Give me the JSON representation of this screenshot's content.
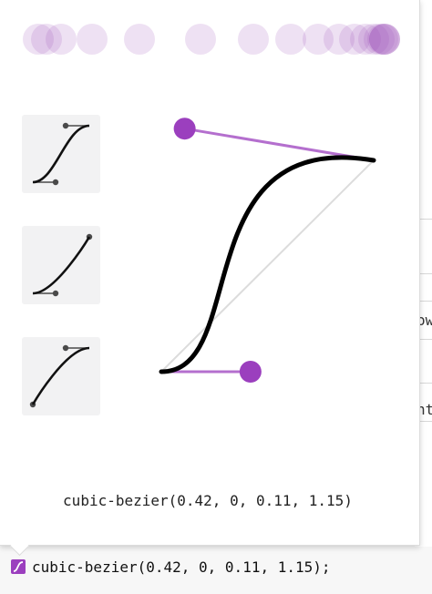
{
  "popover": {
    "timing_function": "cubic-bezier(0.42, 0, 0.11, 1.15)",
    "bezier": {
      "x1": 0.42,
      "y1": 0,
      "x2": 0.11,
      "y2": 1.15
    },
    "accent_color": "#9b3fbe",
    "presets": [
      {
        "name": "ease-in-out"
      },
      {
        "name": "ease-in"
      },
      {
        "name": "ease-out"
      }
    ]
  },
  "declaration": {
    "value": "cubic-bezier(0.42, 0, 0.11, 1.15);",
    "swatch_icon": "bezier-swatch-icon"
  },
  "background": {
    "snippets": [
      "ow",
      "nt"
    ]
  }
}
